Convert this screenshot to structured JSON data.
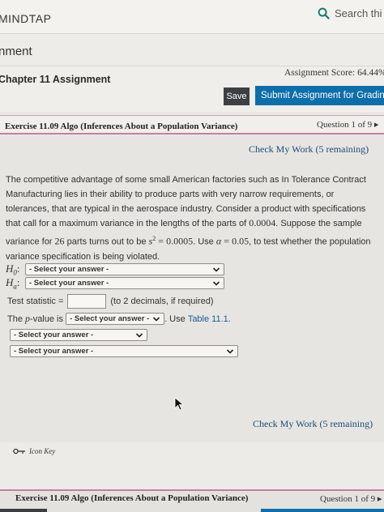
{
  "header": {
    "brand": "MINDTAP",
    "search_text": "Search thi"
  },
  "module": {
    "title": "nment"
  },
  "assignment": {
    "chapter": "Chapter 11 Assignment",
    "score": "Assignment Score: 64.44%",
    "save_label": "Save",
    "submit_label": "Submit Assignment for Grading"
  },
  "exercise": {
    "title": "Exercise 11.09 Algo (Inferences About a Population Variance)",
    "question": "Question 1 of 9"
  },
  "check_link": {
    "label": "Check My Work",
    "remaining": "(5 remaining)"
  },
  "problem": {
    "p1": "The competitive advantage of some small American factories such as In Tolerance Contract Manufacturing lies in their ability to produce parts with very narrow requirements, or tolerances, that are typical in the aerospace industry. Consider a product with specifications that call for a maximum variance in the lengths of the parts of",
    "max_variance": "0.0004",
    "p2": ". Suppose the sample variance for",
    "n": "26",
    "p3": "parts turns out to be",
    "s2_symbol": "s",
    "s2_exp": "2",
    "eq": "=",
    "s2_value": "0.0005",
    "p4": ". Use",
    "alpha_symbol": "α",
    "alpha_value": "0.05",
    "p5": ", to test whether the population variance specification is being violated."
  },
  "form": {
    "h0_label": "H",
    "h0_sub": "0",
    "ha_label": "H",
    "ha_sub": "a",
    "colon": ":",
    "h0_select": "- Select your answer -",
    "ha_select": "- Select your answer -",
    "test_stat_label": "Test statistic =",
    "test_stat_value": "",
    "test_stat_hint": "(to 2 decimals, if required)",
    "pvalue_prefix": "The",
    "pvalue_p": "p",
    "pvalue_suffix": "-value is",
    "pvalue_select": "- Select your answer -",
    "use_table_prefix": ". Use",
    "use_table_link": "Table 11.1",
    "use_table_suffix": ".",
    "select_3": "- Select your answer -",
    "select_4": "- Select your answer -"
  },
  "icon_key": {
    "label": "Icon Key"
  },
  "footer": {
    "title": "Exercise 11.09 Algo (Inferences About a Population Variance)",
    "question": "Question 1 of 9"
  }
}
